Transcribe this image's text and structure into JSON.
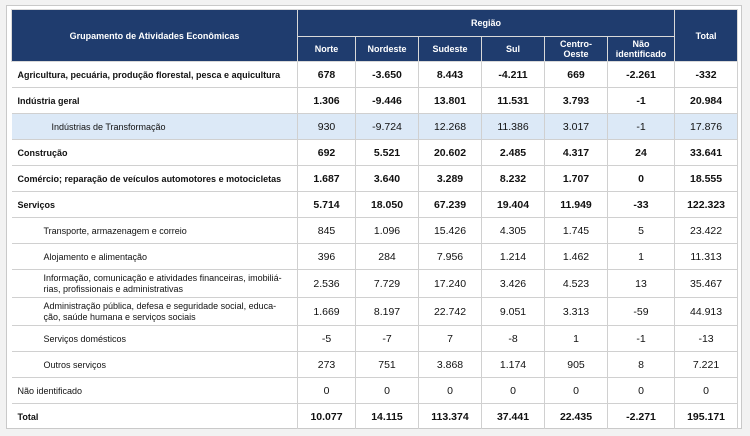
{
  "header": {
    "group_label": "Grupamento de Atividades Econômicas",
    "region_label": "Região",
    "columns": [
      "Norte",
      "Nordeste",
      "Sudeste",
      "Sul",
      "Centro-\nOeste",
      "Não\nidentificado"
    ],
    "total_label": "Total"
  },
  "rows": [
    {
      "label": "Agricultura, pecuária, produção florestal, pesca e aquicultura",
      "values": [
        "678",
        "-3.650",
        "8.443",
        "-4.211",
        "669",
        "-2.261",
        "-332"
      ]
    },
    {
      "label": "Indústria geral",
      "values": [
        "1.306",
        "-9.446",
        "13.801",
        "11.531",
        "3.793",
        "-1",
        "20.984"
      ]
    },
    {
      "label": "Indústrias de Transformação",
      "values": [
        "930",
        "-9.724",
        "12.268",
        "11.386",
        "3.017",
        "-1",
        "17.876"
      ]
    },
    {
      "label": "Construção",
      "values": [
        "692",
        "5.521",
        "20.602",
        "2.485",
        "4.317",
        "24",
        "33.641"
      ]
    },
    {
      "label": "Comércio; reparação de veículos automotores e motocicletas",
      "values": [
        "1.687",
        "3.640",
        "3.289",
        "8.232",
        "1.707",
        "0",
        "18.555"
      ]
    },
    {
      "label": "Serviços",
      "values": [
        "5.714",
        "18.050",
        "67.239",
        "19.404",
        "11.949",
        "-33",
        "122.323"
      ]
    },
    {
      "label": "Transporte, armazenagem e correio",
      "values": [
        "845",
        "1.096",
        "15.426",
        "4.305",
        "1.745",
        "5",
        "23.422"
      ]
    },
    {
      "label": "Alojamento e alimentação",
      "values": [
        "396",
        "284",
        "7.956",
        "1.214",
        "1.462",
        "1",
        "11.313"
      ]
    },
    {
      "label": "Informação, comunicação e atividades financeiras, imobiliá-\nrias, profissionais e administrativas",
      "values": [
        "2.536",
        "7.729",
        "17.240",
        "3.426",
        "4.523",
        "13",
        "35.467"
      ]
    },
    {
      "label": "Administração pública, defesa e seguridade social, educa-\nção, saúde humana e serviços sociais",
      "values": [
        "1.669",
        "8.197",
        "22.742",
        "9.051",
        "3.313",
        "-59",
        "44.913"
      ]
    },
    {
      "label": "Serviços domésticos",
      "values": [
        "-5",
        "-7",
        "7",
        "-8",
        "1",
        "-1",
        "-13"
      ]
    },
    {
      "label": "Outros serviços",
      "values": [
        "273",
        "751",
        "3.868",
        "1.174",
        "905",
        "8",
        "7.221"
      ]
    },
    {
      "label": "Não identificado",
      "values": [
        "0",
        "0",
        "0",
        "0",
        "0",
        "0",
        "0"
      ]
    },
    {
      "label": "Total",
      "values": [
        "10.077",
        "14.115",
        "113.374",
        "37.441",
        "22.435",
        "-2.271",
        "195.171"
      ]
    }
  ]
}
